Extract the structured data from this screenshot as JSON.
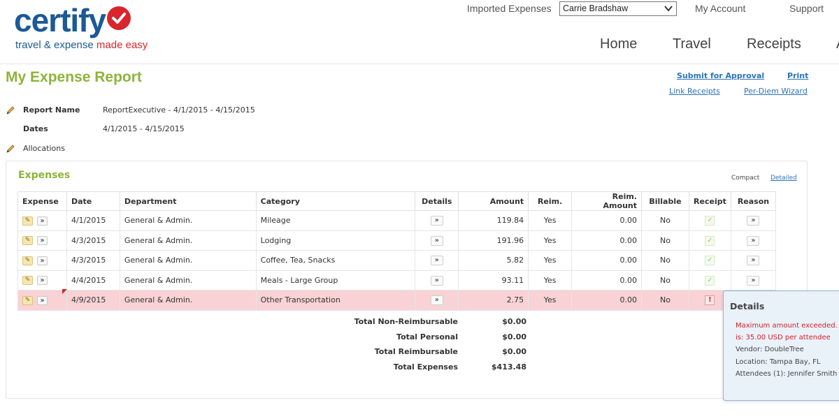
{
  "brand": {
    "name": "certify",
    "tagline_part1": "travel & expense ",
    "tagline_part2": "made easy",
    "accent_blue": "#1b5a96",
    "accent_red": "#d9252b",
    "accent_green": "#8db33a"
  },
  "top_nav": {
    "imported_expenses": "Imported Expenses",
    "user_selected": "Carrie Bradshaw",
    "my_account": "My Account",
    "support": "Support"
  },
  "main_nav": {
    "home": "Home",
    "travel": "Travel",
    "receipts": "Receipts",
    "more": "A"
  },
  "page": {
    "title": "My Expense Report",
    "actions": {
      "submit": "Submit for Approval",
      "print": "Print",
      "link_receipts": "Link Receipts",
      "per_diem": "Per-Diem Wizard"
    }
  },
  "report": {
    "name_label": "Report Name",
    "name_value": "ReportExecutive - 4/1/2015 - 4/15/2015",
    "dates_label": "Dates",
    "dates_value": "4/1/2015 - 4/15/2015",
    "allocations_label": "Allocations"
  },
  "expenses": {
    "title": "Expenses",
    "view_compact": "Compact",
    "view_detailed": "Detailed",
    "columns": [
      "Expense",
      "Date",
      "Department",
      "Category",
      "Details",
      "Amount",
      "Reim.",
      "Reim. Amount",
      "Billable",
      "Receipt",
      "Reason"
    ],
    "rows": [
      {
        "date": "4/1/2015",
        "department": "General & Admin.",
        "category": "Mileage",
        "amount": "119.84",
        "reim": "Yes",
        "reim_amount": "0.00",
        "billable": "No",
        "receipt": "ok"
      },
      {
        "date": "4/3/2015",
        "department": "General & Admin.",
        "category": "Lodging",
        "amount": "191.96",
        "reim": "Yes",
        "reim_amount": "0.00",
        "billable": "No",
        "receipt": "ok"
      },
      {
        "date": "4/3/2015",
        "department": "General & Admin.",
        "category": "Coffee, Tea, Snacks",
        "amount": "5.82",
        "reim": "Yes",
        "reim_amount": "0.00",
        "billable": "No",
        "receipt": "ok"
      },
      {
        "date": "4/4/2015",
        "department": "General & Admin.",
        "category": "Meals - Large Group",
        "amount": "93.11",
        "reim": "Yes",
        "reim_amount": "0.00",
        "billable": "No",
        "receipt": "ok"
      },
      {
        "date": "4/9/2015",
        "department": "General & Admin.",
        "category": "Other Transportation",
        "amount": "2.75",
        "reim": "Yes",
        "reim_amount": "0.00",
        "billable": "No",
        "receipt": "alert"
      }
    ],
    "flag_color": "#f8d2d4"
  },
  "totals": {
    "non_reimbursable_label": "Total Non-Reimbursable",
    "non_reimbursable_value": "$0.00",
    "personal_label": "Total Personal",
    "personal_value": "$0.00",
    "reimbursable_label": "Total Reimbursable",
    "reimbursable_value": "$0.00",
    "expenses_label": "Total Expenses",
    "expenses_value": "$413.48"
  },
  "details_popover": {
    "title": "Details",
    "line1": "Maximum amount exceeded.",
    "line2": "is: 35.00 USD per attendee",
    "vendor": "Vendor: DoubleTree",
    "location": "Location: Tampa Bay, FL",
    "attendees": "Attendees (1): Jennifer Smith"
  }
}
